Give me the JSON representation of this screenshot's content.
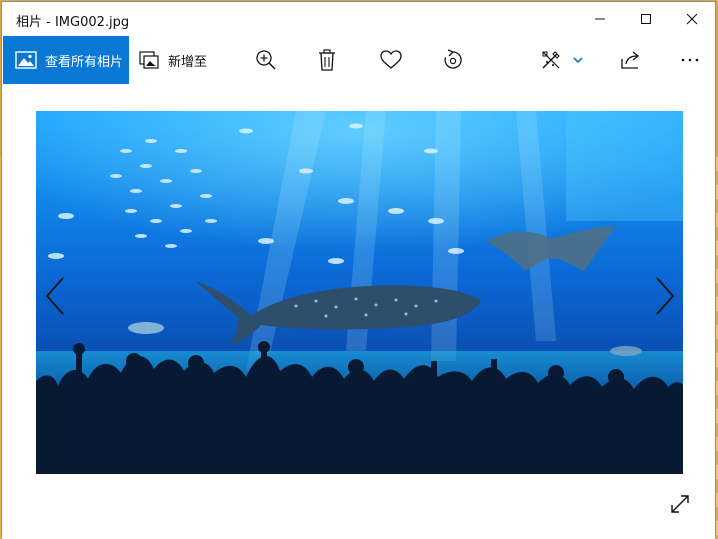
{
  "window": {
    "title": "相片 - IMG002.jpg"
  },
  "toolbar": {
    "see_all_label": "查看所有相片",
    "add_to_label": "新增至",
    "icons": [
      "zoom-in-icon",
      "delete-icon",
      "favorite-icon",
      "rotate-icon",
      "edit-create-icon",
      "share-icon",
      "more-icon"
    ]
  },
  "photo": {
    "subject": "aquarium"
  },
  "colors": {
    "accent": "#0a79d6",
    "photo_top": "#1aa6ff",
    "photo_bottom": "#052a6b"
  }
}
